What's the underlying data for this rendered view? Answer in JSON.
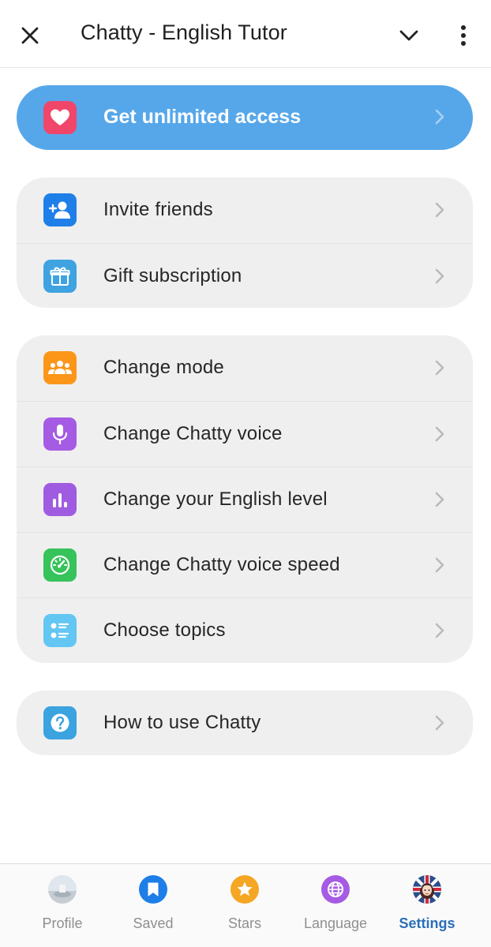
{
  "header": {
    "title": "Chatty - English Tutor"
  },
  "promo": {
    "label": "Get unlimited access",
    "color": "#56a7ea",
    "icon": "heart-icon"
  },
  "groups": [
    {
      "items": [
        {
          "label": "Invite friends",
          "icon": "add-person-icon",
          "color": "#1f7fe8"
        },
        {
          "label": "Gift subscription",
          "icon": "gift-icon",
          "color": "#3ea3e0"
        }
      ]
    },
    {
      "items": [
        {
          "label": "Change mode",
          "icon": "group-icon",
          "color": "#fb9619"
        },
        {
          "label": "Change Chatty voice",
          "icon": "microphone-icon",
          "color": "#a55be3"
        },
        {
          "label": "Change your English level",
          "icon": "bar-chart-icon",
          "color": "#a05ce0"
        },
        {
          "label": "Change Chatty voice speed",
          "icon": "speedometer-icon",
          "color": "#36c35a"
        },
        {
          "label": "Choose topics",
          "icon": "list-icon",
          "color": "#63c6f3"
        }
      ]
    },
    {
      "items": [
        {
          "label": "How to use Chatty",
          "icon": "question-icon",
          "color": "#3aa3e0"
        }
      ]
    }
  ],
  "tabs": [
    {
      "label": "Profile",
      "icon": "profile-photo-icon"
    },
    {
      "label": "Saved",
      "icon": "bookmark-icon",
      "color": "#1e7ee8"
    },
    {
      "label": "Stars",
      "icon": "star-icon",
      "color": "#f5a623"
    },
    {
      "label": "Language",
      "icon": "globe-icon",
      "color": "#a55be3"
    },
    {
      "label": "Settings",
      "icon": "avatar-icon",
      "active": true
    }
  ]
}
